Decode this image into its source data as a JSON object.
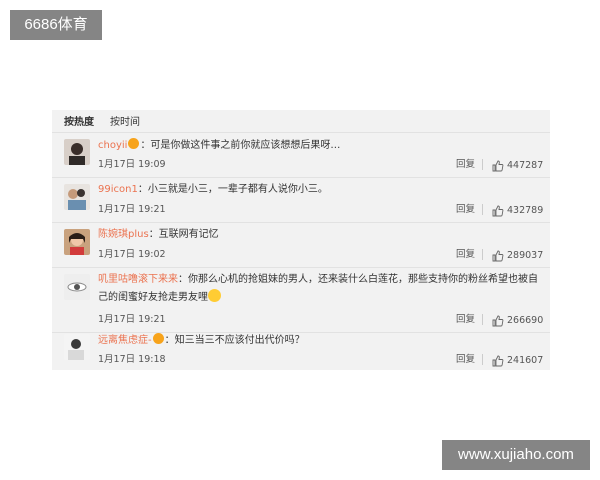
{
  "watermark_top": "6686体育",
  "watermark_bottom": "www.xujiaho.com",
  "tabs": {
    "hot": "按热度",
    "time": "按时间"
  },
  "reply_label": "回复",
  "comments": [
    {
      "user": "choyii",
      "text": "：可是你做这件事之前你就应该想想后果呀…",
      "time": "1月17日 19:09",
      "likes": "447287"
    },
    {
      "user": "99icon1",
      "text": "：小三就是小三，一辈子都有人说你小三。",
      "time": "1月17日 19:21",
      "likes": "432789"
    },
    {
      "user": "陈婉琪plus",
      "text": "：互联网有记忆",
      "time": "1月17日 19:02",
      "likes": "289037"
    },
    {
      "user": "叽里咕噜滚下来来",
      "text": "：你那么心机的抢姐妹的男人，还来装什么白莲花，那些支持你的粉丝希望也被自己的闺蜜好友抢走男友哩",
      "time": "1月17日 19:21",
      "likes": "266690"
    },
    {
      "user": "远离焦虑症-",
      "text": "：知三当三不应该付出代价吗？",
      "time": "1月17日 19:18",
      "likes": "241607"
    }
  ],
  "colors": {
    "username": "#eb7350",
    "panel_bg": "#f2f2f2"
  }
}
